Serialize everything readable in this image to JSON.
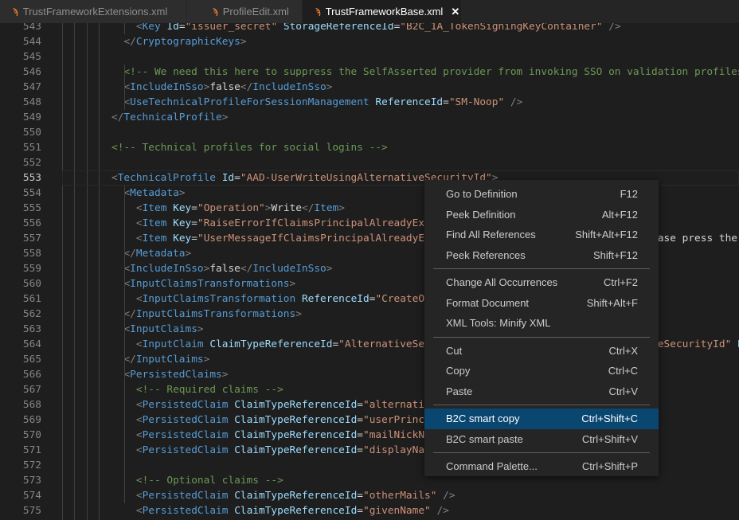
{
  "tabs": [
    {
      "label": "TrustFrameworkExtensions.xml",
      "icon": "rss-file-icon",
      "active": false
    },
    {
      "label": "ProfileEdit.xml",
      "icon": "rss-file-icon",
      "active": false
    },
    {
      "label": "TrustFrameworkBase.xml",
      "icon": "rss-file-icon",
      "active": true,
      "close": "✕"
    }
  ],
  "editor": {
    "current_line": 553,
    "lines": [
      {
        "n": "543",
        "indent": 2,
        "parts": [
          [
            "t",
            "<"
          ],
          [
            "n",
            "Key"
          ],
          [
            "x",
            " "
          ],
          [
            "a",
            "Id"
          ],
          [
            "x",
            "="
          ],
          [
            "s",
            "\"issuer_secret\""
          ],
          [
            "x",
            " "
          ],
          [
            "a",
            "StorageReferenceId"
          ],
          [
            "x",
            "="
          ],
          [
            "s",
            "\"B2C_1A_TokenSigningKeyContainer\""
          ],
          [
            "x",
            " "
          ],
          [
            "t",
            "/>"
          ]
        ]
      },
      {
        "n": "544",
        "indent": 1,
        "parts": [
          [
            "t",
            "</"
          ],
          [
            "n",
            "CryptographicKeys"
          ],
          [
            "t",
            ">"
          ]
        ]
      },
      {
        "n": "545",
        "indent": 0,
        "parts": []
      },
      {
        "n": "546",
        "indent": 1,
        "parts": [
          [
            "c",
            "<!-- We need this here to suppress the SelfAsserted provider from invoking SSO on validation profiles. -->"
          ]
        ]
      },
      {
        "n": "547",
        "indent": 1,
        "parts": [
          [
            "t",
            "<"
          ],
          [
            "n",
            "IncludeInSso"
          ],
          [
            "t",
            ">"
          ],
          [
            "x",
            "false"
          ],
          [
            "t",
            "</"
          ],
          [
            "n",
            "IncludeInSso"
          ],
          [
            "t",
            ">"
          ]
        ]
      },
      {
        "n": "548",
        "indent": 1,
        "parts": [
          [
            "t",
            "<"
          ],
          [
            "n",
            "UseTechnicalProfileForSessionManagement"
          ],
          [
            "x",
            " "
          ],
          [
            "a",
            "ReferenceId"
          ],
          [
            "x",
            "="
          ],
          [
            "s",
            "\"SM-Noop\""
          ],
          [
            "x",
            " "
          ],
          [
            "t",
            "/>"
          ]
        ]
      },
      {
        "n": "549",
        "indent": 0,
        "parts": [
          [
            "t",
            "</"
          ],
          [
            "n",
            "TechnicalProfile"
          ],
          [
            "t",
            ">"
          ]
        ]
      },
      {
        "n": "550",
        "indent": 0,
        "parts": []
      },
      {
        "n": "551",
        "indent": 0,
        "parts": [
          [
            "c",
            "<!-- Technical profiles for social logins -->"
          ]
        ]
      },
      {
        "n": "552",
        "indent": 0,
        "parts": []
      },
      {
        "n": "553",
        "indent": 0,
        "parts": [
          [
            "t",
            "<"
          ],
          [
            "n",
            "TechnicalProfile"
          ],
          [
            "x",
            " "
          ],
          [
            "a",
            "Id"
          ],
          [
            "x",
            "="
          ],
          [
            "s",
            "\"AAD-UserWriteUsingAlternativeSecurityId\""
          ],
          [
            "t",
            ">"
          ]
        ]
      },
      {
        "n": "554",
        "indent": 1,
        "parts": [
          [
            "t",
            "<"
          ],
          [
            "n",
            "Metadata"
          ],
          [
            "t",
            ">"
          ]
        ]
      },
      {
        "n": "555",
        "indent": 2,
        "parts": [
          [
            "t",
            "<"
          ],
          [
            "n",
            "Item"
          ],
          [
            "x",
            " "
          ],
          [
            "a",
            "Key"
          ],
          [
            "x",
            "="
          ],
          [
            "s",
            "\"Operation\""
          ],
          [
            "t",
            ">"
          ],
          [
            "x",
            "Write"
          ],
          [
            "t",
            "</"
          ],
          [
            "n",
            "Item"
          ],
          [
            "t",
            ">"
          ]
        ]
      },
      {
        "n": "556",
        "indent": 2,
        "parts": [
          [
            "t",
            "<"
          ],
          [
            "n",
            "Item"
          ],
          [
            "x",
            " "
          ],
          [
            "a",
            "Key"
          ],
          [
            "x",
            "="
          ],
          [
            "s",
            "\"RaiseErrorIfClaimsPrincipalAlreadyExists\""
          ]
        ]
      },
      {
        "n": "557",
        "indent": 2,
        "parts": [
          [
            "t",
            "<"
          ],
          [
            "n",
            "Item"
          ],
          [
            "x",
            " "
          ],
          [
            "a",
            "Key"
          ],
          [
            "x",
            "="
          ],
          [
            "s",
            "\"UserMessageIfClaimsPrincipalAlreadyExists\""
          ],
          [
            "t",
            ">"
          ],
          [
            "x",
            "You are already registered, please press the"
          ]
        ]
      },
      {
        "n": "558",
        "indent": 1,
        "parts": [
          [
            "t",
            "</"
          ],
          [
            "n",
            "Metadata"
          ],
          [
            "t",
            ">"
          ]
        ]
      },
      {
        "n": "559",
        "indent": 1,
        "parts": [
          [
            "t",
            "<"
          ],
          [
            "n",
            "IncludeInSso"
          ],
          [
            "t",
            ">"
          ],
          [
            "x",
            "false"
          ],
          [
            "t",
            "</"
          ],
          [
            "n",
            "IncludeInSso"
          ],
          [
            "t",
            ">"
          ]
        ]
      },
      {
        "n": "560",
        "indent": 1,
        "parts": [
          [
            "t",
            "<"
          ],
          [
            "n",
            "InputClaimsTransformations"
          ],
          [
            "t",
            ">"
          ]
        ]
      },
      {
        "n": "561",
        "indent": 2,
        "parts": [
          [
            "t",
            "<"
          ],
          [
            "n",
            "InputClaimsTransformation"
          ],
          [
            "x",
            " "
          ],
          [
            "a",
            "ReferenceId"
          ],
          [
            "x",
            "="
          ],
          [
            "s",
            "\"CreateOtherMailsFromEmail\""
          ]
        ]
      },
      {
        "n": "562",
        "indent": 1,
        "parts": [
          [
            "t",
            "</"
          ],
          [
            "n",
            "InputClaimsTransformations"
          ],
          [
            "t",
            ">"
          ]
        ]
      },
      {
        "n": "563",
        "indent": 1,
        "parts": [
          [
            "t",
            "<"
          ],
          [
            "n",
            "InputClaims"
          ],
          [
            "t",
            ">"
          ]
        ]
      },
      {
        "n": "564",
        "indent": 2,
        "parts": [
          [
            "t",
            "<"
          ],
          [
            "n",
            "InputClaim"
          ],
          [
            "x",
            " "
          ],
          [
            "a",
            "ClaimTypeReferenceId"
          ],
          [
            "x",
            "="
          ],
          [
            "s",
            "\"AlternativeSecurityId\""
          ],
          [
            "x",
            " "
          ],
          [
            "a",
            "PartnerClaimType"
          ],
          [
            "x",
            "="
          ],
          [
            "s",
            "\"alternativeSecurityId\""
          ],
          [
            "x",
            " "
          ],
          [
            "a",
            "P"
          ]
        ]
      },
      {
        "n": "565",
        "indent": 1,
        "parts": [
          [
            "t",
            "</"
          ],
          [
            "n",
            "InputClaims"
          ],
          [
            "t",
            ">"
          ]
        ]
      },
      {
        "n": "566",
        "indent": 1,
        "parts": [
          [
            "t",
            "<"
          ],
          [
            "n",
            "PersistedClaims"
          ],
          [
            "t",
            ">"
          ]
        ]
      },
      {
        "n": "567",
        "indent": 2,
        "parts": [
          [
            "c",
            "<!-- Required claims -->"
          ]
        ]
      },
      {
        "n": "568",
        "indent": 2,
        "parts": [
          [
            "t",
            "<"
          ],
          [
            "n",
            "PersistedClaim"
          ],
          [
            "x",
            " "
          ],
          [
            "a",
            "ClaimTypeReferenceId"
          ],
          [
            "x",
            "="
          ],
          [
            "s",
            "\"alternativeSecurityId\""
          ]
        ]
      },
      {
        "n": "569",
        "indent": 2,
        "parts": [
          [
            "t",
            "<"
          ],
          [
            "n",
            "PersistedClaim"
          ],
          [
            "x",
            " "
          ],
          [
            "a",
            "ClaimTypeReferenceId"
          ],
          [
            "x",
            "="
          ],
          [
            "s",
            "\"userPrincipalName\""
          ]
        ]
      },
      {
        "n": "570",
        "indent": 2,
        "parts": [
          [
            "t",
            "<"
          ],
          [
            "n",
            "PersistedClaim"
          ],
          [
            "x",
            " "
          ],
          [
            "a",
            "ClaimTypeReferenceId"
          ],
          [
            "x",
            "="
          ],
          [
            "s",
            "\"mailNickName\""
          ]
        ]
      },
      {
        "n": "571",
        "indent": 2,
        "parts": [
          [
            "t",
            "<"
          ],
          [
            "n",
            "PersistedClaim"
          ],
          [
            "x",
            " "
          ],
          [
            "a",
            "ClaimTypeReferenceId"
          ],
          [
            "x",
            "="
          ],
          [
            "s",
            "\"displayName\""
          ]
        ]
      },
      {
        "n": "572",
        "indent": 0,
        "parts": []
      },
      {
        "n": "573",
        "indent": 2,
        "parts": [
          [
            "c",
            "<!-- Optional claims -->"
          ]
        ]
      },
      {
        "n": "574",
        "indent": 2,
        "parts": [
          [
            "t",
            "<"
          ],
          [
            "n",
            "PersistedClaim"
          ],
          [
            "x",
            " "
          ],
          [
            "a",
            "ClaimTypeReferenceId"
          ],
          [
            "x",
            "="
          ],
          [
            "s",
            "\"otherMails\""
          ],
          [
            "x",
            " "
          ],
          [
            "t",
            "/>"
          ]
        ]
      },
      {
        "n": "575",
        "indent": 2,
        "parts": [
          [
            "t",
            "<"
          ],
          [
            "n",
            "PersistedClaim"
          ],
          [
            "x",
            " "
          ],
          [
            "a",
            "ClaimTypeReferenceId"
          ],
          [
            "x",
            "="
          ],
          [
            "s",
            "\"givenName\""
          ],
          [
            "x",
            " "
          ],
          [
            "t",
            "/>"
          ]
        ]
      }
    ]
  },
  "context_menu": {
    "groups": [
      [
        {
          "label": "Go to Definition",
          "shortcut": "F12"
        },
        {
          "label": "Peek Definition",
          "shortcut": "Alt+F12"
        },
        {
          "label": "Find All References",
          "shortcut": "Shift+Alt+F12"
        },
        {
          "label": "Peek References",
          "shortcut": "Shift+F12"
        }
      ],
      [
        {
          "label": "Change All Occurrences",
          "shortcut": "Ctrl+F2"
        },
        {
          "label": "Format Document",
          "shortcut": "Shift+Alt+F"
        },
        {
          "label": "XML Tools: Minify XML",
          "shortcut": ""
        }
      ],
      [
        {
          "label": "Cut",
          "shortcut": "Ctrl+X"
        },
        {
          "label": "Copy",
          "shortcut": "Ctrl+C"
        },
        {
          "label": "Paste",
          "shortcut": "Ctrl+V"
        }
      ],
      [
        {
          "label": "B2C smart copy",
          "shortcut": "Ctrl+Shift+C",
          "selected": true
        },
        {
          "label": "B2C smart paste",
          "shortcut": "Ctrl+Shift+V"
        }
      ],
      [
        {
          "label": "Command Palette...",
          "shortcut": "Ctrl+Shift+P"
        }
      ]
    ]
  },
  "colors": {
    "accent_selected": "#094771",
    "file_icon": "#e37933"
  }
}
